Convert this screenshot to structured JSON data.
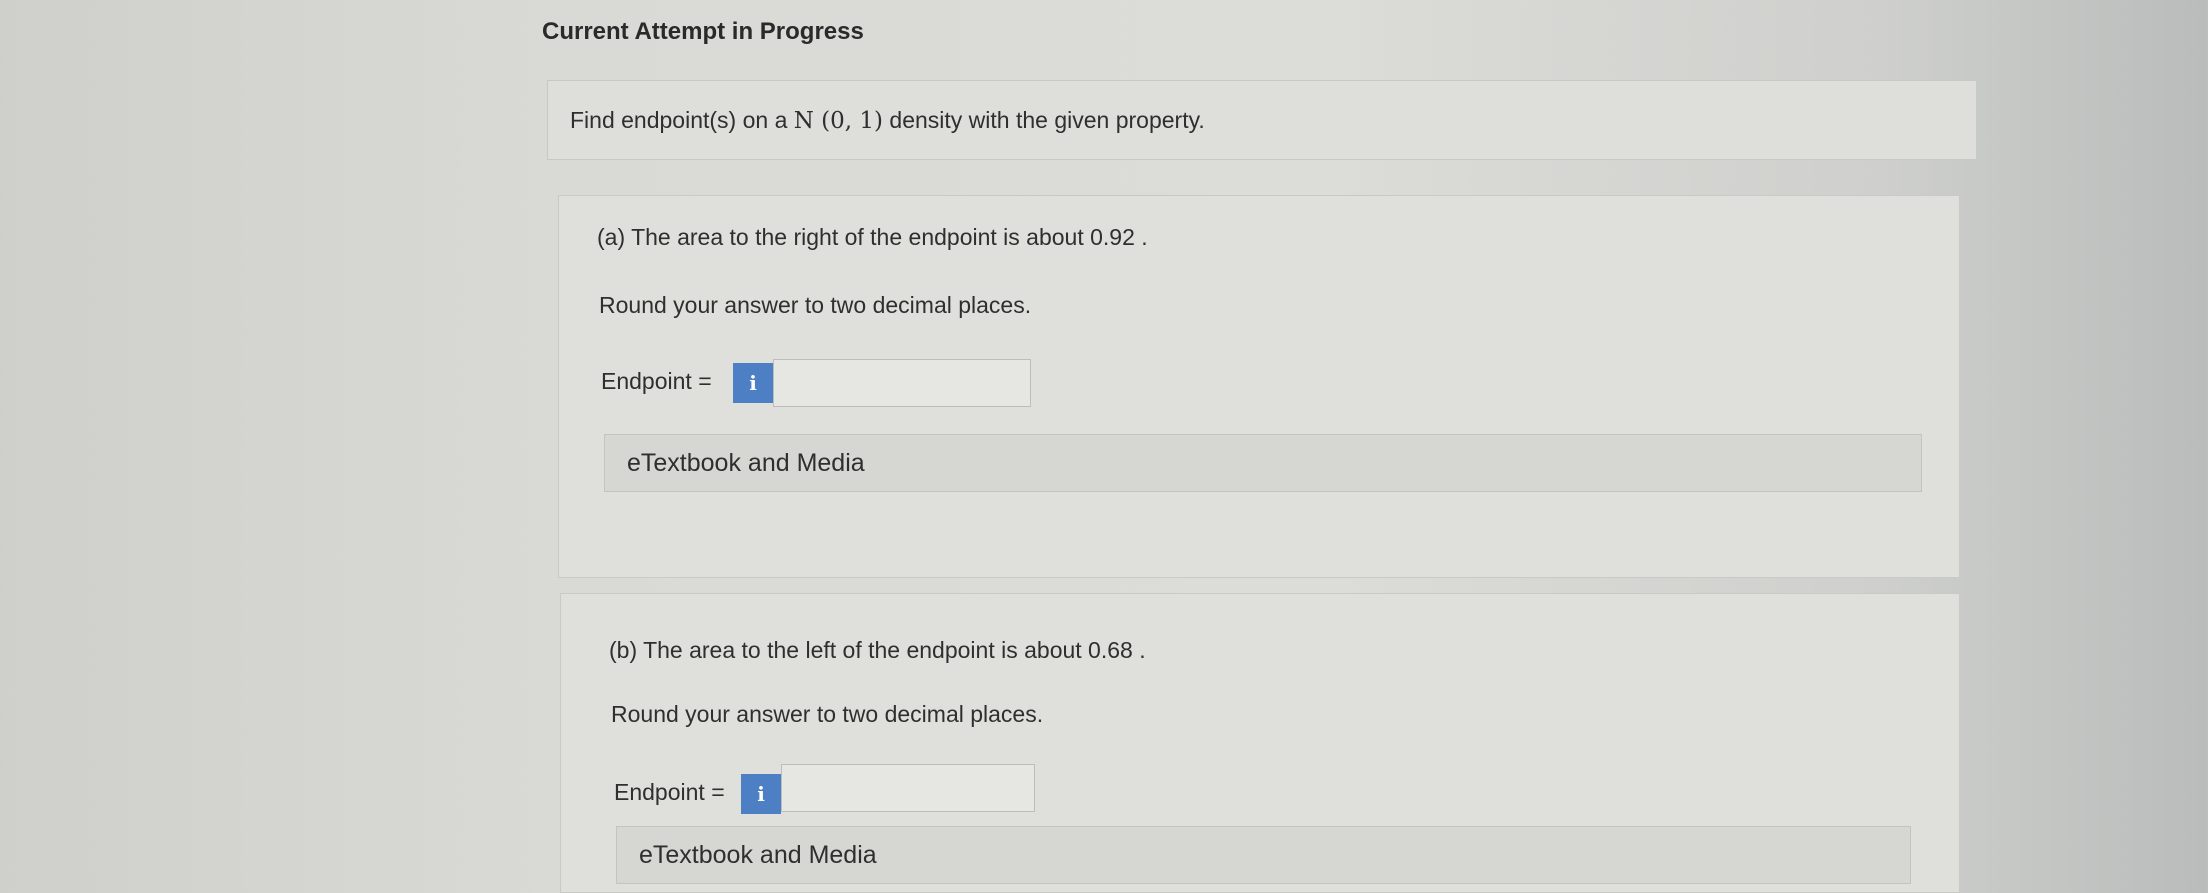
{
  "page": {
    "heading": "Current Attempt in Progress"
  },
  "intro": {
    "before": "Find endpoint(s) on a ",
    "math": "N (0, 1)",
    "after": " density with the given property."
  },
  "part_a": {
    "question": "(a) The area to the right of the endpoint is about 0.92 .",
    "instruction": "Round your answer to two decimal places.",
    "endpoint_label": "Endpoint =",
    "info_icon": "i",
    "endpoint_value": "",
    "media_label": "eTextbook and Media"
  },
  "part_b": {
    "question": "(b) The area to the left of the endpoint is about 0.68 .",
    "instruction": "Round your answer to two decimal places.",
    "endpoint_label": "Endpoint =",
    "info_icon": "i",
    "endpoint_value": "",
    "media_label": "eTextbook and Media"
  },
  "colors": {
    "info_button": "#4d7fc4"
  }
}
